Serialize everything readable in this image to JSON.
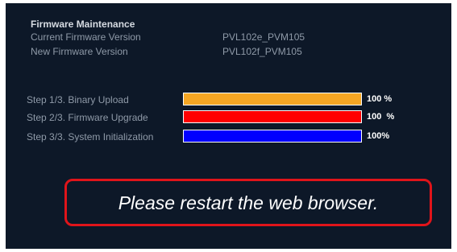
{
  "header": {
    "title": "Firmware Maintenance"
  },
  "firmware": {
    "current_label": "Current Firmware Version",
    "current_value": "PVL102e_PVM105",
    "new_label": "New Firmware Version",
    "new_value": "PVL102f_PVM105"
  },
  "steps": [
    {
      "label": "Step 1/3. Binary Upload",
      "percent_text": "100 %",
      "progress": 1.0,
      "color": "#f5a623"
    },
    {
      "label": "Step 2/3. Firmware Upgrade",
      "percent_text": "100  %",
      "progress": 1.0,
      "color": "#ff0000"
    },
    {
      "label": "Step 3/3. System Initialization",
      "percent_text": "100%",
      "progress": 1.0,
      "color": "#0000ff"
    }
  ],
  "notice": {
    "message": "Please restart the web browser.",
    "border_color": "#e0141a"
  },
  "colors": {
    "background": "#0d1828",
    "muted_text": "#8f9aa8"
  }
}
